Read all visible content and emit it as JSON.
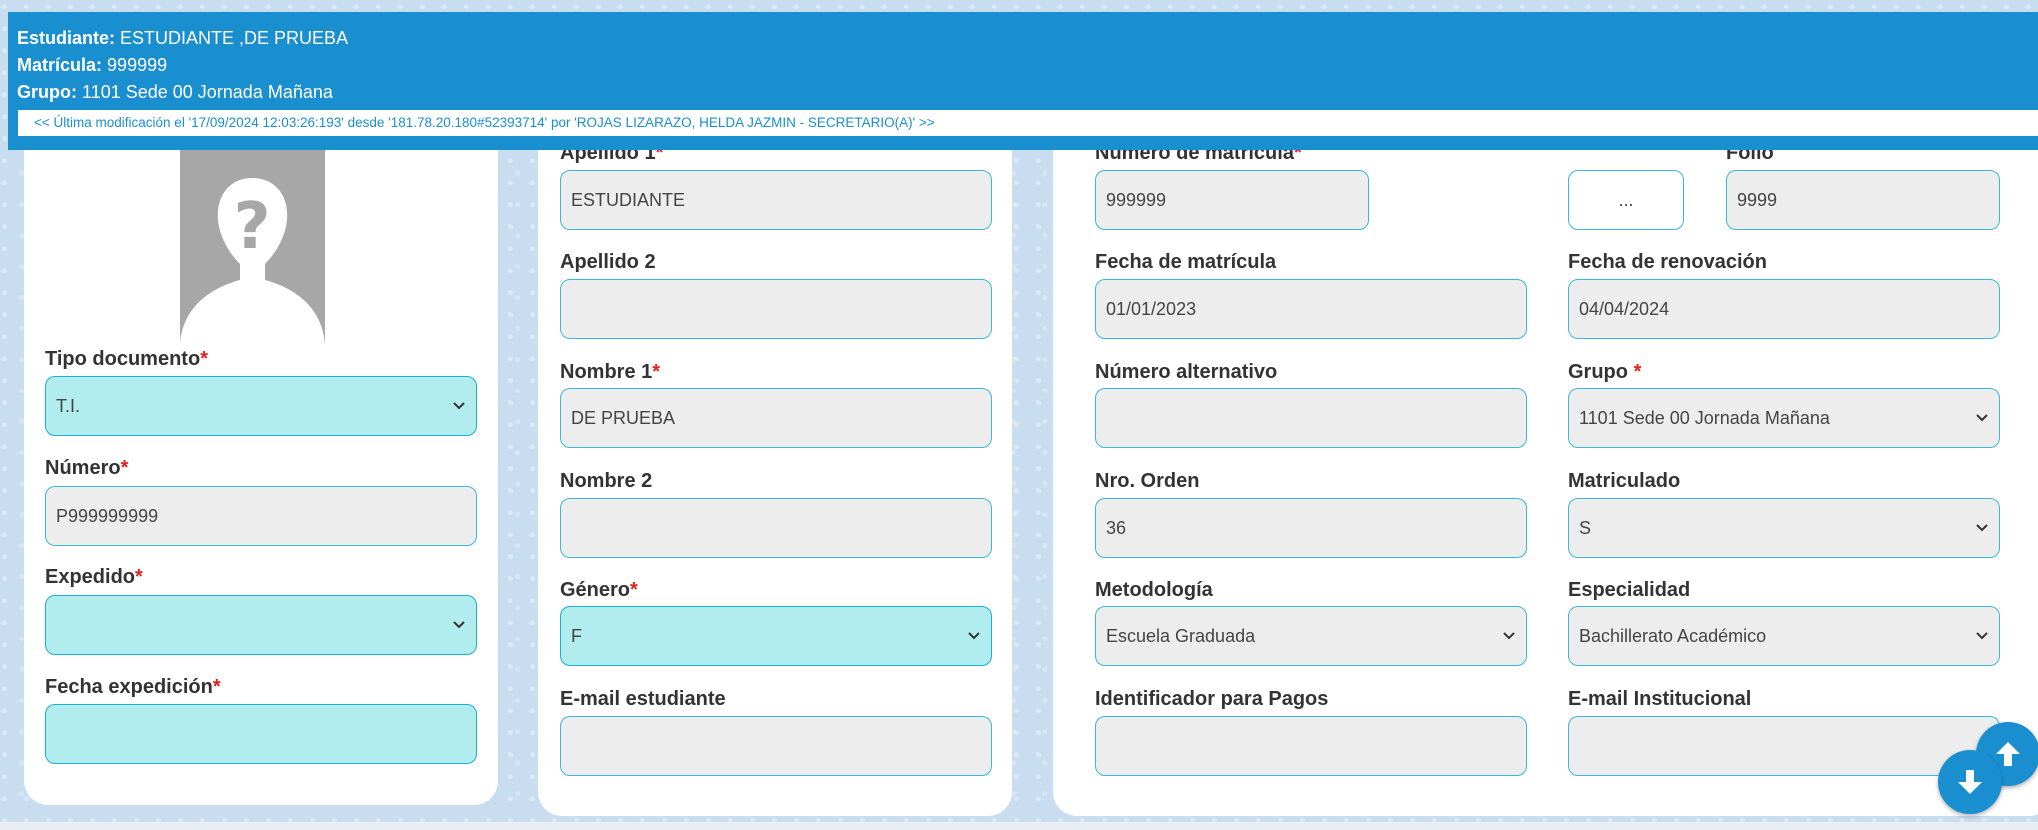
{
  "banner": {
    "student_label": "Estudiante:",
    "student_value": "ESTUDIANTE ,DE PRUEBA",
    "matricula_label": "Matrícula:",
    "matricula_value": "999999",
    "grupo_label": "Grupo:",
    "grupo_value": "1101 Sede 00 Jornada Mañana",
    "modification": "<< Última modificación el '17/09/2024 12:03:26:193' desde '181.78.20.180#52393714' por 'ROJAS LIZARAZO, HELDA JAZMIN - SECRETARIO(A)' >>"
  },
  "col1": {
    "tipo_documento": {
      "label": "Tipo documento",
      "value": "T.I."
    },
    "numero": {
      "label": "Número",
      "value": "P999999999"
    },
    "expedido": {
      "label": "Expedido",
      "value": ""
    },
    "fecha_expedicion": {
      "label": "Fecha expedición",
      "value": ""
    }
  },
  "col2": {
    "apellido1": {
      "label": "Apellido 1",
      "value": "ESTUDIANTE"
    },
    "apellido2": {
      "label": "Apellido 2",
      "value": ""
    },
    "nombre1": {
      "label": "Nombre 1",
      "value": "DE PRUEBA"
    },
    "nombre2": {
      "label": "Nombre 2",
      "value": ""
    },
    "genero": {
      "label": "Género",
      "value": "F"
    },
    "email_estudiante": {
      "label": "E-mail estudiante",
      "value": ""
    }
  },
  "col3": {
    "numero_matricula": {
      "label": "Número de matrícula",
      "value": "999999"
    },
    "folio_button": "...",
    "folio": {
      "label": "Folio",
      "value": "9999"
    },
    "fecha_matricula": {
      "label": "Fecha de matrícula",
      "value": "01/01/2023"
    },
    "fecha_renovacion": {
      "label": "Fecha de renovación",
      "value": "04/04/2024"
    },
    "numero_alternativo": {
      "label": "Número alternativo",
      "value": ""
    },
    "grupo": {
      "label": "Grupo",
      "value": "1101 Sede 00 Jornada Mañana"
    },
    "nro_orden": {
      "label": "Nro. Orden",
      "value": "36"
    },
    "matriculado": {
      "label": "Matriculado",
      "value": "S"
    },
    "metodologia": {
      "label": "Metodología",
      "value": "Escuela Graduada"
    },
    "especialidad": {
      "label": "Especialidad",
      "value": "Bachillerato Académico"
    },
    "identificador_pagos": {
      "label": "Identificador para Pagos",
      "value": ""
    },
    "email_institucional": {
      "label": "E-mail Institucional",
      "value": ""
    }
  },
  "required_mark": "*",
  "icons": {
    "photo": "unknown-person-icon",
    "select": "chevron-down-icon",
    "up": "arrow-up-icon",
    "down": "arrow-down-icon"
  },
  "colors": {
    "banner": "#1a8fcf",
    "field_border": "#3bb7de",
    "cyan_field": "#b1ecee",
    "required": "#e0201f"
  }
}
